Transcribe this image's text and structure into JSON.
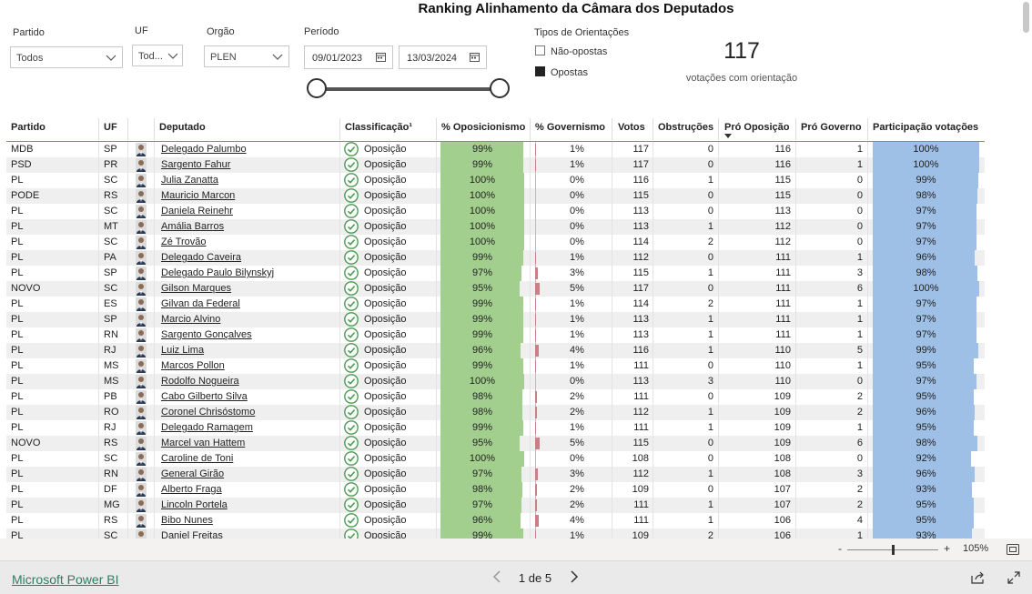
{
  "title": "Ranking Alinhamento da Câmara dos Deputados",
  "filters": {
    "partido": {
      "label": "Partido",
      "value": "Todos"
    },
    "uf": {
      "label": "UF",
      "value": "Tod..."
    },
    "orgao": {
      "label": "Orgão",
      "value": "PLEN"
    },
    "periodo": {
      "label": "Período",
      "start": "09/01/2023",
      "end": "13/03/2024"
    },
    "tipos": {
      "label": "Tipos de Orientações",
      "items": [
        "Não-opostas",
        "Opostas"
      ]
    }
  },
  "kpi": {
    "value": "117",
    "label": "votações com orientação"
  },
  "colors": {
    "accent_green": "#a3cf8e",
    "gov_bar": "#c97f86",
    "participation_bar": "#9ec0e6",
    "check_green": "#6aa84f"
  },
  "table": {
    "headers": {
      "partido": "Partido",
      "uf": "UF",
      "deputado": "Deputado",
      "classificacao": "Classificação¹",
      "oposicionismo": "% Oposicionismo",
      "governismo": "% Governismo",
      "votos": "Votos",
      "obstrucoes": "Obstruções",
      "pro_oposicao": "Pró Oposição",
      "pro_governo": "Pró Governo",
      "participacao": "Participação votações"
    },
    "rows": [
      {
        "partido": "MDB",
        "uf": "SP",
        "deputado": "Delegado Palumbo",
        "classificacao": "Oposição",
        "op": "99%",
        "op_v": 99,
        "gov": "1%",
        "gov_v": 1,
        "votos": "117",
        "obs": "0",
        "pro_op": "116",
        "pro_gov": "1",
        "part": "100%",
        "part_v": 100
      },
      {
        "partido": "PSD",
        "uf": "PR",
        "deputado": "Sargento Fahur",
        "classificacao": "Oposição",
        "op": "99%",
        "op_v": 99,
        "gov": "1%",
        "gov_v": 1,
        "votos": "117",
        "obs": "0",
        "pro_op": "116",
        "pro_gov": "1",
        "part": "100%",
        "part_v": 100
      },
      {
        "partido": "PL",
        "uf": "SC",
        "deputado": "Julia Zanatta",
        "classificacao": "Oposição",
        "op": "100%",
        "op_v": 100,
        "gov": "0%",
        "gov_v": 0,
        "votos": "116",
        "obs": "1",
        "pro_op": "115",
        "pro_gov": "0",
        "part": "99%",
        "part_v": 99
      },
      {
        "partido": "PODE",
        "uf": "RS",
        "deputado": "Mauricio Marcon",
        "classificacao": "Oposição",
        "op": "100%",
        "op_v": 100,
        "gov": "0%",
        "gov_v": 0,
        "votos": "115",
        "obs": "0",
        "pro_op": "115",
        "pro_gov": "0",
        "part": "98%",
        "part_v": 98
      },
      {
        "partido": "PL",
        "uf": "SC",
        "deputado": "Daniela Reinehr",
        "classificacao": "Oposição",
        "op": "100%",
        "op_v": 100,
        "gov": "0%",
        "gov_v": 0,
        "votos": "113",
        "obs": "0",
        "pro_op": "113",
        "pro_gov": "0",
        "part": "97%",
        "part_v": 97
      },
      {
        "partido": "PL",
        "uf": "MT",
        "deputado": "Amália Barros",
        "classificacao": "Oposição",
        "op": "100%",
        "op_v": 100,
        "gov": "0%",
        "gov_v": 0,
        "votos": "113",
        "obs": "1",
        "pro_op": "112",
        "pro_gov": "0",
        "part": "97%",
        "part_v": 97
      },
      {
        "partido": "PL",
        "uf": "SC",
        "deputado": "Zé Trovão",
        "classificacao": "Oposição",
        "op": "100%",
        "op_v": 100,
        "gov": "0%",
        "gov_v": 0,
        "votos": "114",
        "obs": "2",
        "pro_op": "112",
        "pro_gov": "0",
        "part": "97%",
        "part_v": 97
      },
      {
        "partido": "PL",
        "uf": "PA",
        "deputado": "Delegado Caveira",
        "classificacao": "Oposição",
        "op": "99%",
        "op_v": 99,
        "gov": "1%",
        "gov_v": 1,
        "votos": "112",
        "obs": "0",
        "pro_op": "111",
        "pro_gov": "1",
        "part": "96%",
        "part_v": 96
      },
      {
        "partido": "PL",
        "uf": "SP",
        "deputado": "Delegado Paulo Bilynskyj",
        "classificacao": "Oposição",
        "op": "97%",
        "op_v": 97,
        "gov": "3%",
        "gov_v": 3,
        "votos": "115",
        "obs": "1",
        "pro_op": "111",
        "pro_gov": "3",
        "part": "98%",
        "part_v": 98
      },
      {
        "partido": "NOVO",
        "uf": "SC",
        "deputado": "Gilson Marques",
        "classificacao": "Oposição",
        "op": "95%",
        "op_v": 95,
        "gov": "5%",
        "gov_v": 5,
        "votos": "117",
        "obs": "0",
        "pro_op": "111",
        "pro_gov": "6",
        "part": "100%",
        "part_v": 100
      },
      {
        "partido": "PL",
        "uf": "ES",
        "deputado": "Gilvan da Federal",
        "classificacao": "Oposição",
        "op": "99%",
        "op_v": 99,
        "gov": "1%",
        "gov_v": 1,
        "votos": "114",
        "obs": "2",
        "pro_op": "111",
        "pro_gov": "1",
        "part": "97%",
        "part_v": 97
      },
      {
        "partido": "PL",
        "uf": "SP",
        "deputado": "Marcio Alvino",
        "classificacao": "Oposição",
        "op": "99%",
        "op_v": 99,
        "gov": "1%",
        "gov_v": 1,
        "votos": "113",
        "obs": "1",
        "pro_op": "111",
        "pro_gov": "1",
        "part": "97%",
        "part_v": 97
      },
      {
        "partido": "PL",
        "uf": "RN",
        "deputado": "Sargento Gonçalves",
        "classificacao": "Oposição",
        "op": "99%",
        "op_v": 99,
        "gov": "1%",
        "gov_v": 1,
        "votos": "113",
        "obs": "1",
        "pro_op": "111",
        "pro_gov": "1",
        "part": "97%",
        "part_v": 97
      },
      {
        "partido": "PL",
        "uf": "RJ",
        "deputado": "Luiz Lima",
        "classificacao": "Oposição",
        "op": "96%",
        "op_v": 96,
        "gov": "4%",
        "gov_v": 4,
        "votos": "116",
        "obs": "1",
        "pro_op": "110",
        "pro_gov": "5",
        "part": "99%",
        "part_v": 99
      },
      {
        "partido": "PL",
        "uf": "MS",
        "deputado": "Marcos Pollon",
        "classificacao": "Oposição",
        "op": "99%",
        "op_v": 99,
        "gov": "1%",
        "gov_v": 1,
        "votos": "111",
        "obs": "0",
        "pro_op": "110",
        "pro_gov": "1",
        "part": "95%",
        "part_v": 95
      },
      {
        "partido": "PL",
        "uf": "MS",
        "deputado": "Rodolfo Nogueira",
        "classificacao": "Oposição",
        "op": "100%",
        "op_v": 100,
        "gov": "0%",
        "gov_v": 0,
        "votos": "113",
        "obs": "3",
        "pro_op": "110",
        "pro_gov": "0",
        "part": "97%",
        "part_v": 97
      },
      {
        "partido": "PL",
        "uf": "PB",
        "deputado": "Cabo Gilberto Silva",
        "classificacao": "Oposição",
        "op": "98%",
        "op_v": 98,
        "gov": "2%",
        "gov_v": 2,
        "votos": "111",
        "obs": "0",
        "pro_op": "109",
        "pro_gov": "2",
        "part": "95%",
        "part_v": 95
      },
      {
        "partido": "PL",
        "uf": "RO",
        "deputado": "Coronel Chrisóstomo",
        "classificacao": "Oposição",
        "op": "98%",
        "op_v": 98,
        "gov": "2%",
        "gov_v": 2,
        "votos": "112",
        "obs": "1",
        "pro_op": "109",
        "pro_gov": "2",
        "part": "96%",
        "part_v": 96
      },
      {
        "partido": "PL",
        "uf": "RJ",
        "deputado": "Delegado Ramagem",
        "classificacao": "Oposição",
        "op": "99%",
        "op_v": 99,
        "gov": "1%",
        "gov_v": 1,
        "votos": "111",
        "obs": "1",
        "pro_op": "109",
        "pro_gov": "1",
        "part": "95%",
        "part_v": 95
      },
      {
        "partido": "NOVO",
        "uf": "RS",
        "deputado": "Marcel van Hattem",
        "classificacao": "Oposição",
        "op": "95%",
        "op_v": 95,
        "gov": "5%",
        "gov_v": 5,
        "votos": "115",
        "obs": "0",
        "pro_op": "109",
        "pro_gov": "6",
        "part": "98%",
        "part_v": 98
      },
      {
        "partido": "PL",
        "uf": "SC",
        "deputado": "Caroline de Toni",
        "classificacao": "Oposição",
        "op": "100%",
        "op_v": 100,
        "gov": "0%",
        "gov_v": 0,
        "votos": "108",
        "obs": "0",
        "pro_op": "108",
        "pro_gov": "0",
        "part": "92%",
        "part_v": 92
      },
      {
        "partido": "PL",
        "uf": "RN",
        "deputado": "General Girão",
        "classificacao": "Oposição",
        "op": "97%",
        "op_v": 97,
        "gov": "3%",
        "gov_v": 3,
        "votos": "112",
        "obs": "1",
        "pro_op": "108",
        "pro_gov": "3",
        "part": "96%",
        "part_v": 96
      },
      {
        "partido": "PL",
        "uf": "DF",
        "deputado": "Alberto Fraga",
        "classificacao": "Oposição",
        "op": "98%",
        "op_v": 98,
        "gov": "2%",
        "gov_v": 2,
        "votos": "109",
        "obs": "0",
        "pro_op": "107",
        "pro_gov": "2",
        "part": "93%",
        "part_v": 93
      },
      {
        "partido": "PL",
        "uf": "MG",
        "deputado": "Lincoln Portela",
        "classificacao": "Oposição",
        "op": "97%",
        "op_v": 97,
        "gov": "2%",
        "gov_v": 2,
        "votos": "111",
        "obs": "1",
        "pro_op": "107",
        "pro_gov": "2",
        "part": "95%",
        "part_v": 95
      },
      {
        "partido": "PL",
        "uf": "RS",
        "deputado": "Bibo Nunes",
        "classificacao": "Oposição",
        "op": "96%",
        "op_v": 96,
        "gov": "4%",
        "gov_v": 4,
        "votos": "111",
        "obs": "1",
        "pro_op": "106",
        "pro_gov": "4",
        "part": "95%",
        "part_v": 95
      },
      {
        "partido": "PL",
        "uf": "SC",
        "deputado": "Daniel Freitas",
        "classificacao": "Oposição",
        "op": "99%",
        "op_v": 99,
        "gov": "1%",
        "gov_v": 1,
        "votos": "109",
        "obs": "2",
        "pro_op": "106",
        "pro_gov": "1",
        "part": "93%",
        "part_v": 93
      }
    ]
  },
  "zoom": {
    "minus": "-",
    "plus": "+",
    "level": "105%",
    "level_v": 105
  },
  "footer": {
    "brand": "Microsoft Power BI",
    "page": "1 de 5"
  }
}
